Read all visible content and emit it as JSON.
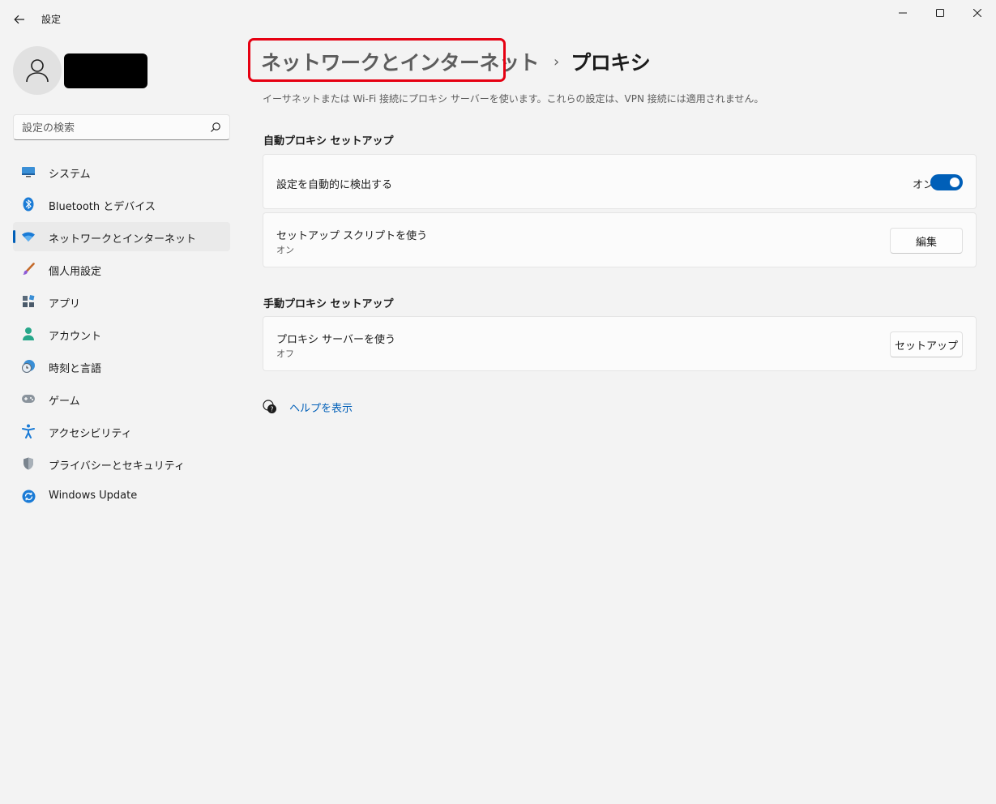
{
  "window": {
    "title": "設定",
    "controls": [
      "minimize",
      "maximize",
      "close"
    ]
  },
  "profile": {
    "avatar_icon": "person-icon"
  },
  "search": {
    "placeholder": "設定の検索"
  },
  "sidebar": {
    "items": [
      {
        "label": "システム",
        "icon": "system-icon",
        "selected": false
      },
      {
        "label": "Bluetooth とデバイス",
        "icon": "bluetooth-icon",
        "selected": false
      },
      {
        "label": "ネットワークとインターネット",
        "icon": "wifi-icon",
        "selected": true
      },
      {
        "label": "個人用設定",
        "icon": "brush-icon",
        "selected": false
      },
      {
        "label": "アプリ",
        "icon": "apps-icon",
        "selected": false
      },
      {
        "label": "アカウント",
        "icon": "account-icon",
        "selected": false
      },
      {
        "label": "時刻と言語",
        "icon": "time-language-icon",
        "selected": false
      },
      {
        "label": "ゲーム",
        "icon": "gamepad-icon",
        "selected": false
      },
      {
        "label": "アクセシビリティ",
        "icon": "accessibility-icon",
        "selected": false
      },
      {
        "label": "プライバシーとセキュリティ",
        "icon": "shield-icon",
        "selected": false
      },
      {
        "label": "Windows Update",
        "icon": "update-icon",
        "selected": false
      }
    ]
  },
  "breadcrumb": {
    "parent": "ネットワークとインターネット",
    "separator": "›",
    "current": "プロキシ"
  },
  "description": "イーサネットまたは Wi-Fi 接続にプロキシ サーバーを使います。これらの設定は、VPN 接続には適用されません。",
  "auto_proxy": {
    "title": "自動プロキシ セットアップ",
    "detect": {
      "label": "設定を自動的に検出する",
      "state_text": "オン",
      "enabled": true
    },
    "script": {
      "label": "セットアップ スクリプトを使う",
      "status": "オン",
      "button": "編集"
    }
  },
  "manual_proxy": {
    "title": "手動プロキシ セットアップ",
    "server": {
      "label": "プロキシ サーバーを使う",
      "status": "オフ",
      "button": "セットアップ"
    }
  },
  "help": {
    "label": "ヘルプを表示",
    "icon": "help-icon"
  },
  "colors": {
    "accent": "#005fb8",
    "highlight_box": "#e60012",
    "background": "#f3f3f3",
    "card": "#fbfbfb"
  }
}
